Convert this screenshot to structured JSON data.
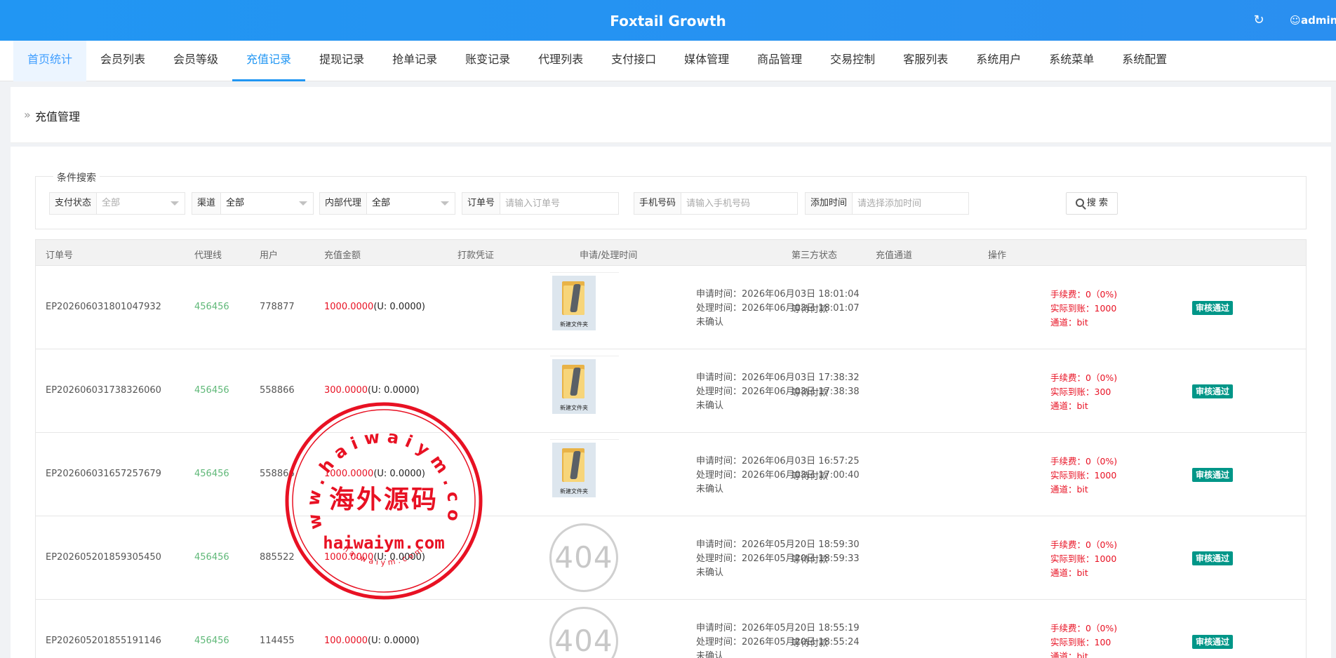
{
  "header": {
    "title": "Foxtail Growth",
    "user": "admin",
    "refresh_icon": "refresh-icon",
    "user_icon": "user-icon",
    "brand_color": "#2196f3"
  },
  "nav": {
    "tabs": [
      "首页统计",
      "会员列表",
      "会员等级",
      "充值记录",
      "提现记录",
      "抢单记录",
      "账变记录",
      "代理列表",
      "支付接口",
      "媒体管理",
      "商品管理",
      "交易控制",
      "客服列表",
      "系统用户",
      "系统菜单",
      "系统配置"
    ],
    "active": "充值记录"
  },
  "panel": {
    "title": "充值管理"
  },
  "search": {
    "legend": "条件搜索",
    "pay_status": {
      "label": "支付状态",
      "value": "全部"
    },
    "channel": {
      "label": "渠道",
      "value": "全部"
    },
    "agent": {
      "label": "内部代理",
      "value": "全部"
    },
    "order": {
      "label": "订单号",
      "placeholder": "请输入订单号"
    },
    "phone": {
      "label": "手机号码",
      "placeholder": "请输入手机号码"
    },
    "time": {
      "label": "添加时间",
      "placeholder": "请选择添加时间"
    },
    "button": "搜 索"
  },
  "table": {
    "headers": [
      "订单号",
      "代理线",
      "用户",
      "充值金额",
      "打款凭证",
      "申请/处理时间",
      "第三方状态",
      "充值通道",
      "操作"
    ],
    "rows": [
      {
        "order": "EP202606031801047932",
        "agent": "456456",
        "user": "778877",
        "amount": "1000.0000",
        "usdt": "(U: 0.0000)",
        "voucher": "folder",
        "voucher_caption": "新建文件夹",
        "apply": "申请时间：2026年06月03日 18:01:04",
        "process": "处理时间：2026年06月03日 18:01:07",
        "confirm": "未确认",
        "third": "等待付款",
        "fee": "手续费：0（0%)",
        "actual": "实际到账：1000",
        "via": "通道：bit",
        "action": "审核通过"
      },
      {
        "order": "EP202606031738326060",
        "agent": "456456",
        "user": "558866",
        "amount": "300.0000",
        "usdt": "(U: 0.0000)",
        "voucher": "folder",
        "voucher_caption": "新建文件夹",
        "apply": "申请时间：2026年06月03日 17:38:32",
        "process": "处理时间：2026年06月03日 17:38:38",
        "confirm": "未确认",
        "third": "等待付款",
        "fee": "手续费：0（0%)",
        "actual": "实际到账：300",
        "via": "通道：bit",
        "action": "审核通过"
      },
      {
        "order": "EP202606031657257679",
        "agent": "456456",
        "user": "558866",
        "amount": "1000.0000",
        "usdt": "(U: 0.0000)",
        "voucher": "folder",
        "voucher_caption": "新建文件夹",
        "apply": "申请时间：2026年06月03日 16:57:25",
        "process": "处理时间：2026年06月03日 17:00:40",
        "confirm": "未确认",
        "third": "等待付款",
        "fee": "手续费：0（0%)",
        "actual": "实际到账：1000",
        "via": "通道：bit",
        "action": "审核通过"
      },
      {
        "order": "EP202605201859305450",
        "agent": "456456",
        "user": "885522",
        "amount": "1000.0000",
        "usdt": "(U: 0.0000)",
        "voucher": "404",
        "voucher_caption": "",
        "apply": "申请时间：2026年05月20日 18:59:30",
        "process": "处理时间：2026年05月20日 18:59:33",
        "confirm": "未确认",
        "third": "等待付款",
        "fee": "手续费：0（0%)",
        "actual": "实际到账：1000",
        "via": "通道：bit",
        "action": "审核通过"
      },
      {
        "order": "EP202605201855191146",
        "agent": "456456",
        "user": "114455",
        "amount": "100.0000",
        "usdt": "(U: 0.0000)",
        "voucher": "404",
        "voucher_caption": "",
        "apply": "申请时间：2026年05月20日 18:55:19",
        "process": "处理时间：2026年05月20日 18:55:24",
        "confirm": "未确认",
        "third": "等待付款",
        "fee": "手续费：0（0%)",
        "actual": "实际到账：100",
        "via": "通道：bit",
        "action": "审核通过"
      }
    ]
  },
  "watermark": {
    "top_text": "www.haiwaiym.com",
    "center_text": "海外源码",
    "domain_text": "haiwaiym.com",
    "bottom_text": "haiwaiym.com",
    "color": "#e81123"
  }
}
